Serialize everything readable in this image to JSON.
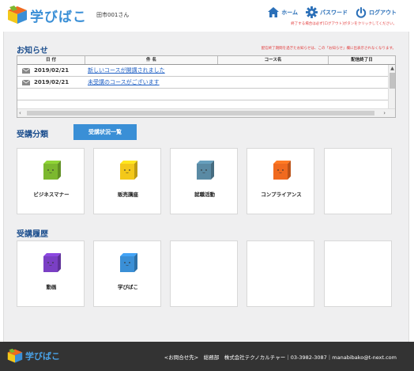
{
  "header": {
    "logo_text": "学びばこ",
    "user_name": "田市001さん",
    "nav": {
      "home": "ホーム",
      "password": "パスワード",
      "logout": "ログアウト"
    },
    "logout_notice": "終了する場合は必ず[ログアウト]ボタンをクリックしてください。"
  },
  "notices": {
    "title": "お知らせ",
    "note": "配信終了期間を過ぎたお知らせは、この「お知らせ」欄に出表示されなくなります。",
    "columns": [
      "日 付",
      "件 名",
      "コース名",
      "配信終了日"
    ],
    "rows": [
      {
        "date": "2019/02/21",
        "subject": "新しいコースが開講されました"
      },
      {
        "date": "2019/02/21",
        "subject": "未受講のコースがございます"
      }
    ]
  },
  "categories": {
    "title": "受講分類",
    "status_button": "受講状況一覧",
    "items": [
      {
        "label": "ビジネスマナー",
        "color": "#7cb82f"
      },
      {
        "label": "販売講座",
        "color": "#f3c81a"
      },
      {
        "label": "就職活動",
        "color": "#5a8aa4"
      },
      {
        "label": "コンプライアンス",
        "color": "#f06a1f"
      },
      {
        "label": "",
        "color": ""
      }
    ]
  },
  "history": {
    "title": "受講履歴",
    "items": [
      {
        "label": "動画",
        "color": "#7a3fc4"
      },
      {
        "label": "学びばこ",
        "color": "#3a8fd6"
      },
      {
        "label": "",
        "color": ""
      },
      {
        "label": "",
        "color": ""
      },
      {
        "label": "",
        "color": ""
      }
    ]
  },
  "footer": {
    "logo_text": "学びばこ",
    "contact": "<お問合せ先>　総務部　株式会社テクノカルチャー｜03-3982-3087｜manabibako@t-next.com"
  }
}
